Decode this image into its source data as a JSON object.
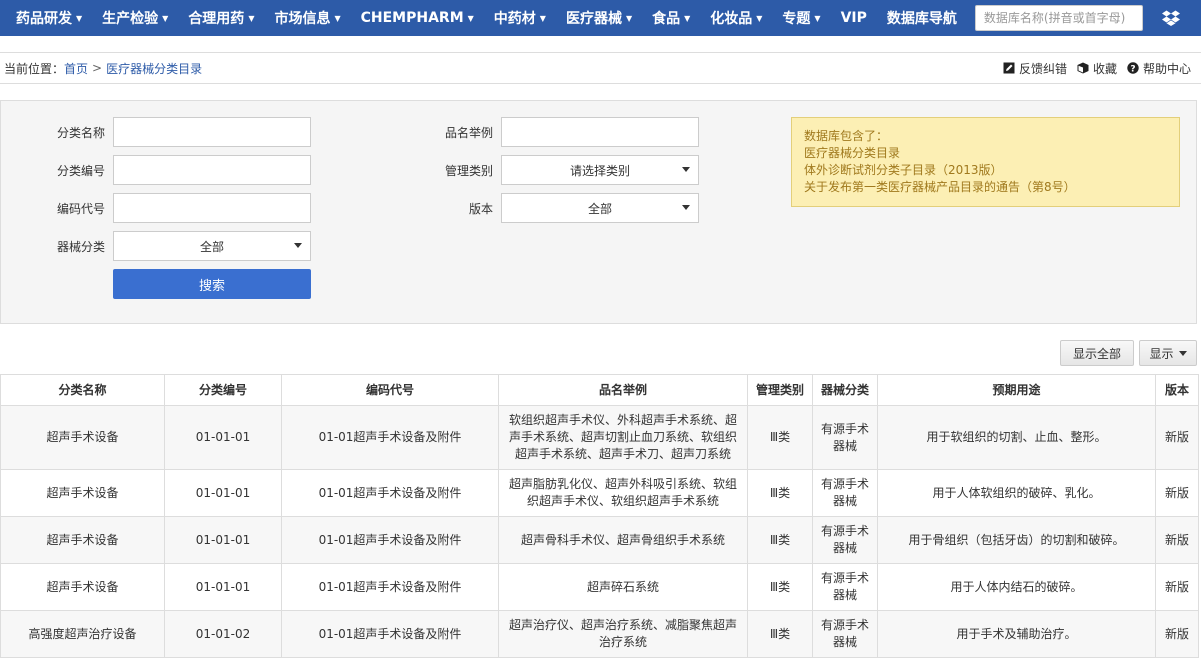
{
  "nav": {
    "items": [
      {
        "label": "药品研发",
        "caret": true
      },
      {
        "label": "生产检验",
        "caret": true
      },
      {
        "label": "合理用药",
        "caret": true
      },
      {
        "label": "市场信息",
        "caret": true
      },
      {
        "label": "CHEMPHARM",
        "caret": true
      },
      {
        "label": "中药材",
        "caret": true
      },
      {
        "label": "医疗器械",
        "caret": true
      },
      {
        "label": "食品",
        "caret": true
      },
      {
        "label": "化妆品",
        "caret": true
      },
      {
        "label": "专题",
        "caret": true
      },
      {
        "label": "VIP",
        "caret": false
      },
      {
        "label": "数据库导航",
        "caret": false
      }
    ],
    "search_placeholder": "数据库名称(拼音或首字母)"
  },
  "breadcrumb": {
    "label": "当前位置：",
    "home": "首页",
    "separator": ">",
    "current": "医疗器械分类目录"
  },
  "tools": {
    "feedback": "反馈纠错",
    "favorite": "收藏",
    "help": "帮助中心"
  },
  "form": {
    "category_name_label": "分类名称",
    "category_code_label": "分类编号",
    "code_label": "编码代号",
    "device_class_label": "器械分类",
    "device_class_value": "全部",
    "product_example_label": "品名举例",
    "mgmt_class_label": "管理类别",
    "mgmt_class_value": "请选择类别",
    "version_label": "版本",
    "version_value": "全部",
    "search_button": "搜索"
  },
  "notice": {
    "title": "数据库包含了：",
    "lines": [
      "医疗器械分类目录",
      "体外诊断试剂分类子目录（2013版）",
      "关于发布第一类医疗器械产品目录的通告（第8号）"
    ]
  },
  "actions": {
    "show_all": "显示全部",
    "display": "显示"
  },
  "table": {
    "headers": [
      "分类名称",
      "分类编号",
      "编码代号",
      "品名举例",
      "管理类别",
      "器械分类",
      "预期用途",
      "版本"
    ],
    "rows": [
      [
        "超声手术设备",
        "01-01-01",
        "01-01超声手术设备及附件",
        "软组织超声手术仪、外科超声手术系统、超声手术系统、超声切割止血刀系统、软组织超声手术系统、超声手术刀、超声刀系统",
        "Ⅲ类",
        "有源手术器械",
        "用于软组织的切割、止血、整形。",
        "新版"
      ],
      [
        "超声手术设备",
        "01-01-01",
        "01-01超声手术设备及附件",
        "超声脂肪乳化仪、超声外科吸引系统、软组织超声手术仪、软组织超声手术系统",
        "Ⅲ类",
        "有源手术器械",
        "用于人体软组织的破碎、乳化。",
        "新版"
      ],
      [
        "超声手术设备",
        "01-01-01",
        "01-01超声手术设备及附件",
        "超声骨科手术仪、超声骨组织手术系统",
        "Ⅲ类",
        "有源手术器械",
        "用于骨组织（包括牙齿）的切割和破碎。",
        "新版"
      ],
      [
        "超声手术设备",
        "01-01-01",
        "01-01超声手术设备及附件",
        "超声碎石系统",
        "Ⅲ类",
        "有源手术器械",
        "用于人体内结石的破碎。",
        "新版"
      ],
      [
        "高强度超声治疗设备",
        "01-01-02",
        "01-01超声手术设备及附件",
        "超声治疗仪、超声治疗系统、减脂聚焦超声治疗系统",
        "Ⅲ类",
        "有源手术器械",
        "用于手术及辅助治疗。",
        "新版"
      ]
    ]
  }
}
